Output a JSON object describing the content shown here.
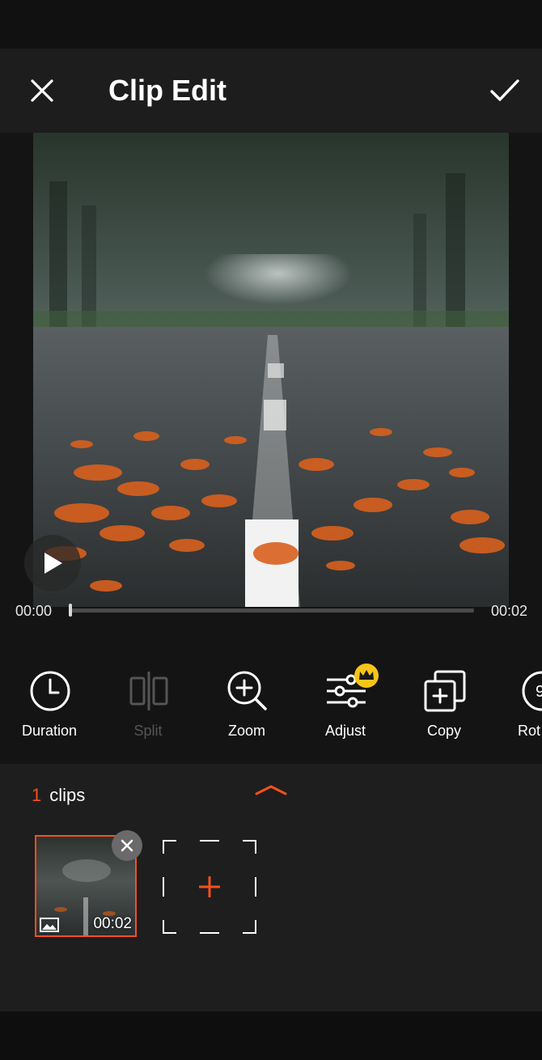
{
  "header": {
    "title": "Clip Edit",
    "close_icon": "close-icon",
    "confirm_icon": "check-icon"
  },
  "player": {
    "current_time": "00:00",
    "total_time": "00:02",
    "progress": 0.0,
    "play_icon": "play-icon"
  },
  "toolbar": {
    "items": [
      {
        "label": "Duration",
        "icon": "clock-icon",
        "enabled": true
      },
      {
        "label": "Split",
        "icon": "split-icon",
        "enabled": false
      },
      {
        "label": "Zoom",
        "icon": "zoom-in-icon",
        "enabled": true
      },
      {
        "label": "Adjust",
        "icon": "sliders-icon",
        "enabled": true,
        "premium": true
      },
      {
        "label": "Copy",
        "icon": "copy-icon",
        "enabled": true
      },
      {
        "label": "Rot",
        "icon": "rotate-icon",
        "enabled": true
      }
    ]
  },
  "clips": {
    "count": "1",
    "label": "clips",
    "items": [
      {
        "duration": "00:02",
        "type_icon": "image-icon"
      }
    ]
  },
  "colors": {
    "accent": "#f4511e",
    "premium": "#f5c518",
    "background": "#141414"
  }
}
